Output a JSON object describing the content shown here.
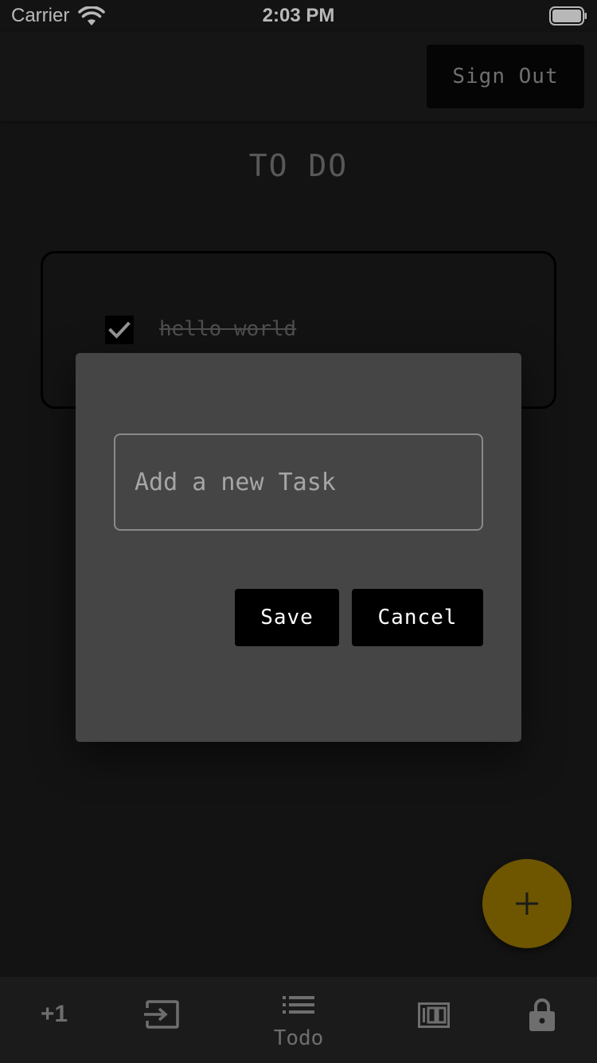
{
  "status_bar": {
    "carrier": "Carrier",
    "time": "2:03 PM"
  },
  "header": {
    "sign_out_label": "Sign Out"
  },
  "page": {
    "title": "TO DO"
  },
  "todos": [
    {
      "text": "hello world",
      "completed": true
    }
  ],
  "dialog": {
    "input_placeholder": "Add a new Task",
    "input_value": "",
    "save_label": "Save",
    "cancel_label": "Cancel"
  },
  "fab": {
    "icon": "plus-icon",
    "color": "#6e5500"
  },
  "tab_bar": {
    "tabs": [
      {
        "icon": "plus-one-icon",
        "label": "+1"
      },
      {
        "icon": "input-icon",
        "label": ""
      },
      {
        "icon": "list-icon",
        "label": "Todo"
      },
      {
        "icon": "hundred-icon",
        "label": ""
      },
      {
        "icon": "lock-icon",
        "label": ""
      }
    ]
  },
  "colors": {
    "background": "#1b1b1b",
    "dialog": "#454545",
    "button": "#000000",
    "accent": "#6e5500",
    "muted_text": "#6e6e6e"
  }
}
